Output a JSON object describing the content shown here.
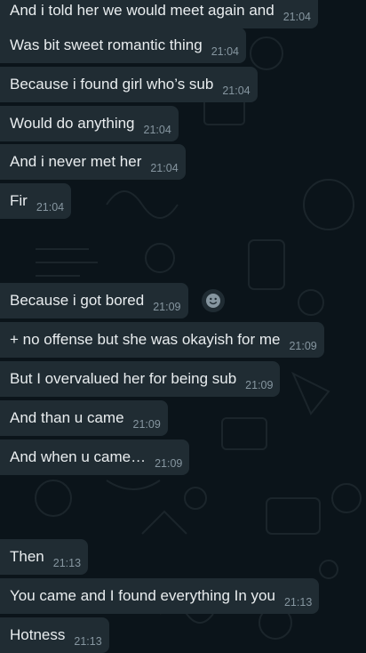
{
  "chat": {
    "messages": [
      {
        "text": "And i told her we would meet again and",
        "time": "21:04"
      },
      {
        "text": "Was bit sweet romantic thing",
        "time": "21:04"
      },
      {
        "text": "Because i found girl who’s sub",
        "time": "21:04"
      },
      {
        "text": "Would do anything",
        "time": "21:04"
      },
      {
        "text": "And i never met  her",
        "time": "21:04"
      },
      {
        "text": "Fir",
        "time": "21:04"
      },
      {
        "text": "Because i got bored",
        "time": "21:09"
      },
      {
        "text": "+ no offense but she was okayish for me",
        "time": "21:09"
      },
      {
        "text": "But I overvalued her for being sub",
        "time": "21:09"
      },
      {
        "text": "And than u came",
        "time": "21:09"
      },
      {
        "text": "And when u came…",
        "time": "21:09"
      },
      {
        "text": "Then",
        "time": "21:13"
      },
      {
        "text": "You came and I found everything In you",
        "time": "21:13"
      },
      {
        "text": "Hotness",
        "time": "21:13"
      }
    ],
    "reaction_icon": "smiley-face-icon"
  },
  "colors": {
    "background": "#0b141a",
    "bubble": "#202c33",
    "text": "#e9edef",
    "timestamp": "#8696a0"
  }
}
